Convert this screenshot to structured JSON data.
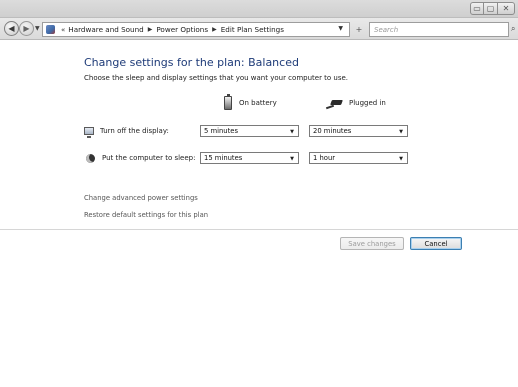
{
  "window": {
    "caption_min": "▭",
    "caption_max": "▢",
    "caption_close": "✕"
  },
  "address_bar": {
    "back_glyph": "◀",
    "forward_glyph": "▶",
    "chevron": "«",
    "breadcrumbs": [
      "Hardware and Sound",
      "Power Options",
      "Edit Plan Settings"
    ],
    "separator": "▶",
    "dropdown_glyph": "▼",
    "refresh_glyph": "+",
    "search_placeholder": "Search",
    "icons": [
      "control-panel-icon",
      "refresh-icon",
      "search-icon"
    ]
  },
  "page": {
    "title": "Change settings for the plan: Balanced",
    "subtitle": "Choose the sleep and display settings that you want your computer to use."
  },
  "columns": {
    "on_battery": "On battery",
    "plugged_in": "Plugged in"
  },
  "settings": {
    "display": {
      "label": "Turn off the display:",
      "on_battery": "5 minutes",
      "plugged_in": "20 minutes"
    },
    "sleep": {
      "label": "Put the computer to sleep:",
      "on_battery": "15 minutes",
      "plugged_in": "1 hour"
    }
  },
  "links": {
    "advanced": "Change advanced power settings",
    "restore": "Restore default settings for this plan"
  },
  "buttons": {
    "save": "Save changes",
    "cancel": "Cancel"
  },
  "colors": {
    "title": "#1e3b78",
    "link": "#555555",
    "default_button_border": "#3c7fb1"
  }
}
